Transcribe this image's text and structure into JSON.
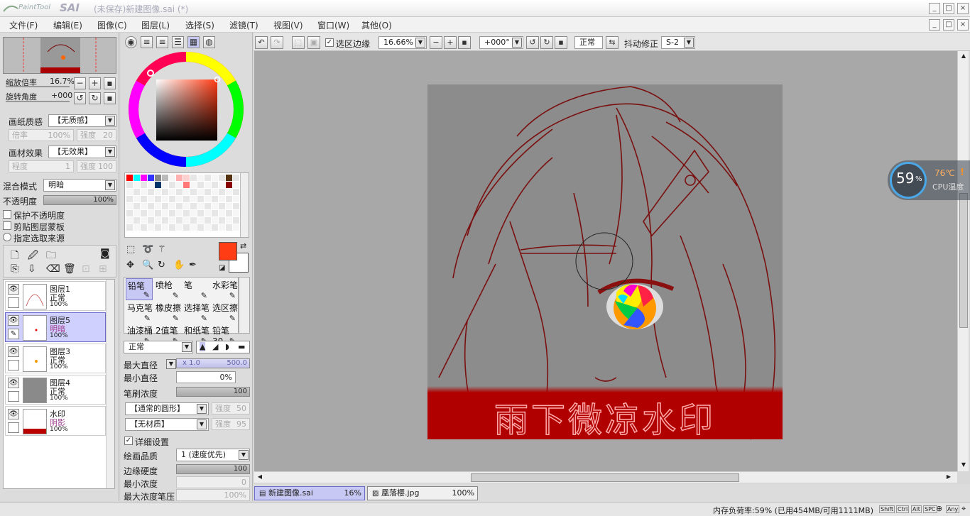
{
  "window": {
    "app_name": "SAI",
    "logo_sub": "PaintTool",
    "title": "(未保存)新建图像.sai (*)",
    "controls": [
      "_",
      "□",
      "×"
    ]
  },
  "menu": [
    "文件(F)",
    "编辑(E)",
    "图像(C)",
    "图层(L)",
    "选择(S)",
    "滤镜(T)",
    "视图(V)",
    "窗口(W)",
    "其他(O)"
  ],
  "navigator": {
    "zoom_label": "缩放倍率",
    "zoom_value": "16.7%",
    "rotate_label": "旋转角度",
    "rotate_value": "+000"
  },
  "paper": {
    "texture_label": "画纸质感",
    "texture_value": "【无质感】",
    "scale_label": "倍率",
    "scale_value": "100%",
    "strength_label": "强度",
    "strength_value": "20",
    "effect_label": "画材效果",
    "effect_value": "【无效果】",
    "degree_label": "程度",
    "degree_value": "1",
    "strength2_label": "强度",
    "strength2_value": "100"
  },
  "layer_props": {
    "blend_label": "混合模式",
    "blend_value": "明暗",
    "opacity_label": "不透明度",
    "opacity_value": "100%",
    "protect_opacity": "保护不透明度",
    "clip_mask": "剪贴图层蒙板",
    "selection_source": "指定选取来源"
  },
  "layers": [
    {
      "name": "图层1",
      "mode": "正常",
      "opacity": "100%",
      "selected": false
    },
    {
      "name": "图层5",
      "mode": "明暗",
      "opacity": "100%",
      "selected": true
    },
    {
      "name": "图层3",
      "mode": "正常",
      "opacity": "100%",
      "selected": false
    },
    {
      "name": "图层4",
      "mode": "正常",
      "opacity": "100%",
      "selected": false
    },
    {
      "name": "水印",
      "mode": "阴影",
      "opacity": "100%",
      "selected": false
    }
  ],
  "color": {
    "primary": "#ff3c14",
    "secondary": "#ffffff",
    "swatches": [
      "#ff0000",
      "#00ffff",
      "#ff00ff",
      "#3333ff",
      "#888888",
      "#bbbbbb",
      "#ffb0b0",
      "#ffd0d0",
      "#553311",
      "#003366",
      "#ff7777",
      "#880000"
    ]
  },
  "tools": [
    {
      "label": "铅笔",
      "selected": true
    },
    {
      "label": "喷枪",
      "selected": false
    },
    {
      "label": "笔",
      "selected": false
    },
    {
      "label": "水彩笔",
      "selected": false
    },
    {
      "label": "马克笔",
      "selected": false
    },
    {
      "label": "橡皮擦",
      "selected": false
    },
    {
      "label": "选择笔",
      "selected": false
    },
    {
      "label": "选区擦",
      "selected": false
    },
    {
      "label": "油漆桶",
      "selected": false
    },
    {
      "label": "2值笔",
      "selected": false
    },
    {
      "label": "和纸笔",
      "selected": false
    },
    {
      "label": "铅笔30",
      "selected": false
    }
  ],
  "brush": {
    "mode": "正常",
    "max_size_label": "最大直径",
    "max_size_mult": "x 1.0",
    "max_size_value": "500.0",
    "min_size_label": "最小直径",
    "min_size_value": "0%",
    "density_label": "笔刷浓度",
    "density_value": "100",
    "shape": "【通常的圆形】",
    "shape_strength_label": "强度",
    "shape_strength": "50",
    "texture": "【无材质】",
    "texture_strength_label": "强度",
    "texture_strength": "95",
    "detail_label": "详细设置",
    "quality_label": "绘画品质",
    "quality_value": "1 (速度优先)",
    "edge_label": "边缘硬度",
    "edge_value": "100",
    "min_density_label": "最小浓度",
    "min_density_value": "0",
    "max_pressure_label": "最大浓度笔压",
    "max_pressure_value": "100%"
  },
  "canvas_toolbar": {
    "select_edge": "选区边缘",
    "zoom": "16.66%",
    "angle": "+000°",
    "blend": "正常",
    "stabilizer_label": "抖动修正",
    "stabilizer_value": "S-2"
  },
  "artwork": {
    "watermark_text": "雨下微凉水印"
  },
  "tabs": [
    {
      "name": "新建图像.sai",
      "zoom": "16%",
      "selected": true
    },
    {
      "name": "凰落樱.jpg",
      "zoom": "100%",
      "selected": false
    }
  ],
  "status": {
    "memory": "内存负荷率:59% (已用454MB/可用1111MB)",
    "keys": [
      "Shift",
      "Ctrl",
      "Alt",
      "SPC",
      "Any"
    ]
  },
  "cpu_widget": {
    "percent": "59",
    "percent_unit": "%",
    "temp": "76℃",
    "label": "CPU温度"
  }
}
